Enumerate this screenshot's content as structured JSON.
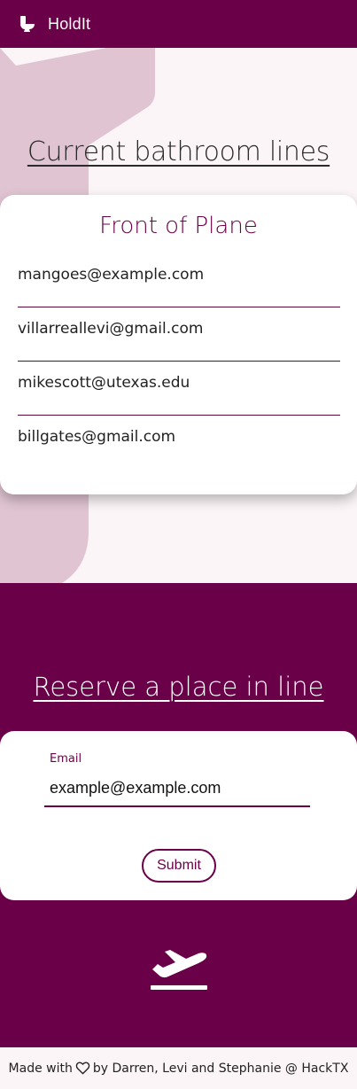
{
  "header": {
    "app_title": "HoldIt",
    "logo_icon": "toilet-icon"
  },
  "lines_section": {
    "title": "Current bathroom lines",
    "card": {
      "title": "Front of Plane",
      "queue": [
        "mangoes@example.com",
        "villarreallevi@gmail.com",
        "mikescott@utexas.edu",
        "billgates@gmail.com"
      ]
    }
  },
  "reserve_section": {
    "title": "Reserve a place in line",
    "email_label": "Email",
    "email_value": "example@example.com",
    "submit_label": "Submit",
    "plane_icon": "airplane-takeoff-icon"
  },
  "footer": {
    "prefix": "Made with",
    "suffix": "by Darren, Levi and Stephanie @ HackTX",
    "heart_icon": "heart-outline-icon"
  },
  "colors": {
    "brand": "#6a0047",
    "background": "#fbf5f7",
    "deco": "#e0c4d2"
  }
}
